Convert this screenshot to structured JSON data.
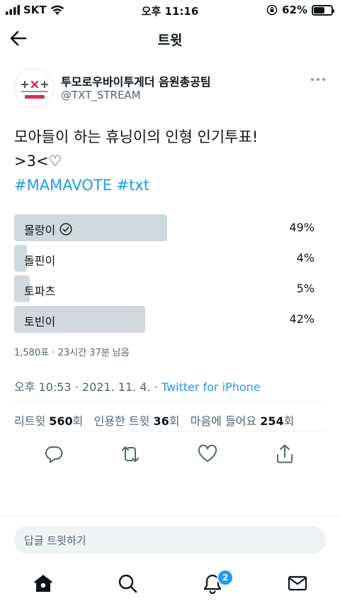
{
  "status_bar": {
    "carrier": "SKT",
    "time": "오후 11:16",
    "battery": "62%",
    "battery_level": 0.62
  },
  "header": {
    "title": "트윗"
  },
  "author": {
    "name": "투모로우바이투게더 음원총공팀",
    "handle": "@TXT_STREAM",
    "avatar_text": {
      "logo": "+×+",
      "sub1": "MOMENTS × MOMENT",
      "sub2": "음원총공팀"
    }
  },
  "tweet": {
    "line1": "모아들이 하는 휴닝이의 인형 인기투표!",
    "line2": ">3<♡",
    "hashtags": "#MAMAVOTE #txt"
  },
  "poll": {
    "options": [
      {
        "label": "몰랑이",
        "percent": "49%",
        "value": 49,
        "winner": true
      },
      {
        "label": "돌핀이",
        "percent": "4%",
        "value": 4,
        "winner": false
      },
      {
        "label": "토파츠",
        "percent": "5%",
        "value": 5,
        "winner": false
      },
      {
        "label": "토빈이",
        "percent": "42%",
        "value": 42,
        "winner": false
      }
    ],
    "meta": "1,580표 · 23시간 37분 남음"
  },
  "timestamp": {
    "time": "오후 10:53 · 2021. 11. 4. · ",
    "source": "Twitter for iPhone"
  },
  "stats": {
    "retweets_label": "리트윗",
    "retweets_count": "560",
    "retweets_unit": "회",
    "quotes_label": "인용한 트윗",
    "quotes_count": "36",
    "quotes_unit": "회",
    "likes_label": "마음에 들어요",
    "likes_count": "254",
    "likes_unit": "회"
  },
  "reply": {
    "placeholder": "답글 트윗하기"
  },
  "tabbar": {
    "notification_badge": "2"
  },
  "colors": {
    "accent": "#1d9bf0",
    "poll_bar": "#cfd9de",
    "muted": "#536471"
  }
}
